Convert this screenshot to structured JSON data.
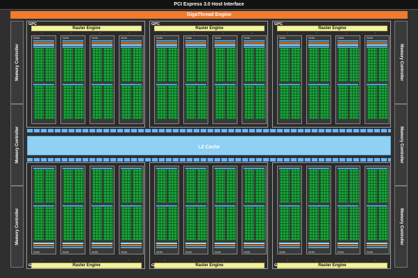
{
  "header": {
    "pcie": "PCI Express 3.0 Host Interface",
    "giga": "GigaThread Engine"
  },
  "memory_controller_label": "Memory Controller",
  "l2_label": "L2 Cache",
  "gpc_label": "GPC",
  "raster_label": "Raster Engine",
  "smm_label": "SMM",
  "layout": {
    "gpc_count": 6,
    "smm_per_gpc": 4,
    "memory_controllers_per_side": 3
  },
  "colors": {
    "background": "#2f2f2f",
    "header_bar": "#121212",
    "gigathread": "#f07b2f",
    "raster_engine": "#f4f29a",
    "cuda_cores": "#19a33a",
    "l2_cache": "#8fd0f3",
    "crossbar": "#1b4f9e"
  }
}
